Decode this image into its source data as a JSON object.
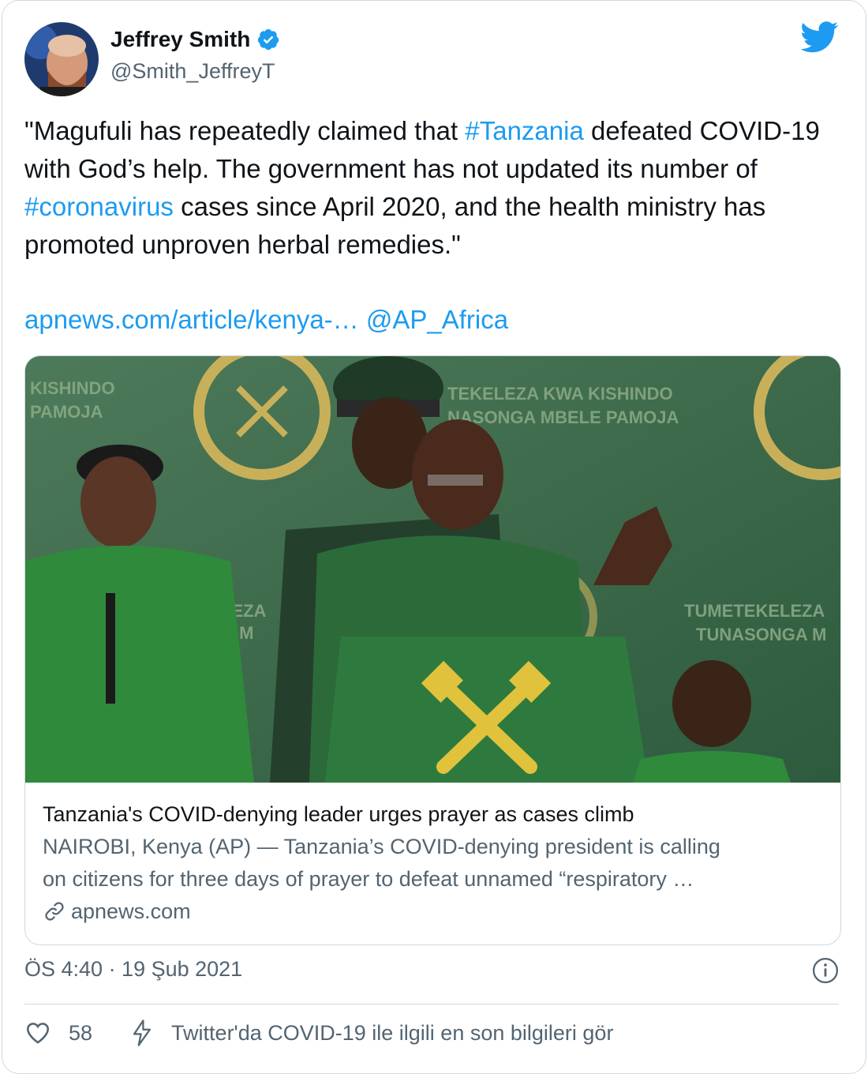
{
  "author": {
    "name": "Jeffrey Smith",
    "handle": "@Smith_JeffreyT",
    "verified": true
  },
  "icons": {
    "verified": "verified-badge-icon",
    "brand": "twitter-bird-icon",
    "link": "link-icon",
    "info": "info-icon",
    "like": "heart-icon",
    "covid": "lightning-icon"
  },
  "colors": {
    "accent": "#1d9bf0",
    "text": "#0f1419",
    "muted": "#536471",
    "border": "#cfd9de"
  },
  "tweet": {
    "text_part1": "\"Magufuli has repeatedly claimed that ",
    "hashtag1": "#Tanzania",
    "text_part2": " defeated COVID-19 with God’s help. The government has not updated its number of ",
    "hashtag2": "#coronavirus",
    "text_part3": " cases since April 2020, and the health ministry has promoted unproven herbal remedies.\"",
    "link": "apnews.com/article/kenya-…",
    "mention": "@AP_Africa"
  },
  "card": {
    "image_signs": {
      "left": [
        "KISHINDO",
        "PAMOJA"
      ],
      "top": [
        "TEKELEZA KWA KISHINDO",
        "NASONGA MBELE PAMOJA"
      ],
      "middle": [
        "LEZA",
        "A M"
      ],
      "right": [
        "TUMETEKELEZA",
        "TUNASONGA M"
      ]
    },
    "title": "Tanzania's COVID-denying leader urges prayer as cases climb",
    "description_line1": "NAIROBI, Kenya (AP) — Tanzania’s COVID-denying president is calling",
    "description_line2": "on citizens for three days of prayer to defeat unnamed “respiratory …",
    "domain": "apnews.com"
  },
  "meta": {
    "timestamp": "ÖS 4:40 · 19 Şub 2021"
  },
  "actions": {
    "like_count": "58",
    "covid_info": "Twitter'da COVID-19 ile ilgili en son bilgileri gör"
  }
}
